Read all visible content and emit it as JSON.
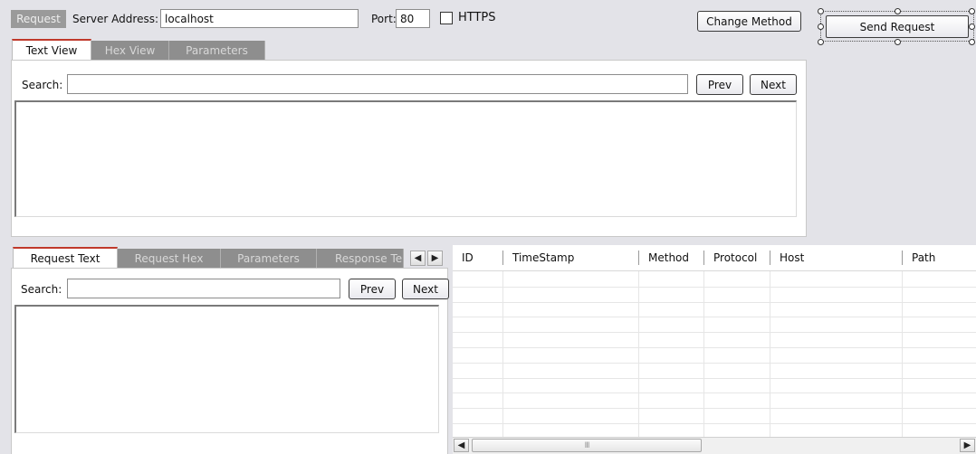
{
  "toolbar": {
    "request_label": "Request",
    "server_label": "Server Address:",
    "server_value": "localhost",
    "port_label": "Port:",
    "port_value": "80",
    "https_label": "HTTPS",
    "change_method": "Change Method",
    "send_request": "Send Request"
  },
  "top_tabs": [
    "Text View",
    "Hex View",
    "Parameters"
  ],
  "top_search": {
    "label": "Search:",
    "prev": "Prev",
    "next": "Next"
  },
  "bottom_tabs": [
    "Request Text",
    "Request Hex",
    "Parameters",
    "Response Te"
  ],
  "bottom_search": {
    "label": "Search:",
    "prev": "Prev",
    "next": "Next"
  },
  "grid": {
    "columns": [
      "ID",
      "TimeStamp",
      "Method",
      "Protocol",
      "Host",
      "Path"
    ],
    "row_count": 11,
    "scroll_thumb_mark": "III"
  },
  "icons": {
    "tab_scroll_left": "◀",
    "tab_scroll_right": "▶",
    "scroll_left": "◀",
    "scroll_right": "▶"
  }
}
